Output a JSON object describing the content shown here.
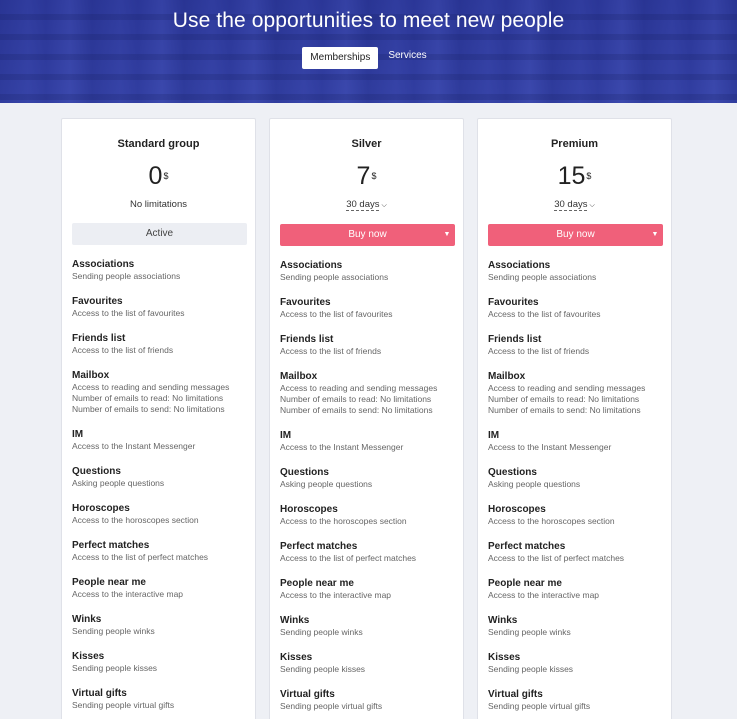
{
  "hero": {
    "title": "Use the opportunities to meet new people",
    "tabs": [
      {
        "label": "Memberships",
        "active": true
      },
      {
        "label": "Services",
        "active": false
      }
    ]
  },
  "plans": [
    {
      "title": "Standard group",
      "price": "0",
      "currency": "$",
      "subtitle": "No limitations",
      "button_label": "Active"
    },
    {
      "title": "Silver",
      "price": "7",
      "currency": "$",
      "period": "30 days",
      "button_label": "Buy now"
    },
    {
      "title": "Premium",
      "price": "15",
      "currency": "$",
      "period": "30 days",
      "button_label": "Buy now"
    }
  ],
  "features": [
    {
      "name": "Associations",
      "desc": [
        "Sending people associations"
      ]
    },
    {
      "name": "Favourites",
      "desc": [
        "Access to the list of favourites"
      ]
    },
    {
      "name": "Friends list",
      "desc": [
        "Access to the list of friends"
      ]
    },
    {
      "name": "Mailbox",
      "desc": [
        "Access to reading and sending messages",
        "Number of emails to read: No limitations",
        "Number of emails to send: No limitations"
      ]
    },
    {
      "name": "IM",
      "desc": [
        "Access to the Instant Messenger"
      ]
    },
    {
      "name": "Questions",
      "desc": [
        "Asking people questions"
      ]
    },
    {
      "name": "Horoscopes",
      "desc": [
        "Access to the horoscopes section"
      ]
    },
    {
      "name": "Perfect matches",
      "desc": [
        "Access to the list of perfect matches"
      ]
    },
    {
      "name": "People near me",
      "desc": [
        "Access to the interactive map"
      ]
    },
    {
      "name": "Winks",
      "desc": [
        "Sending people winks"
      ]
    },
    {
      "name": "Kisses",
      "desc": [
        "Sending people kisses"
      ]
    },
    {
      "name": "Virtual gifts",
      "desc": [
        "Sending people virtual gifts"
      ]
    }
  ],
  "colors": {
    "accent": "#f0607a",
    "hero": "#3442a8",
    "background": "#eef0f5"
  }
}
